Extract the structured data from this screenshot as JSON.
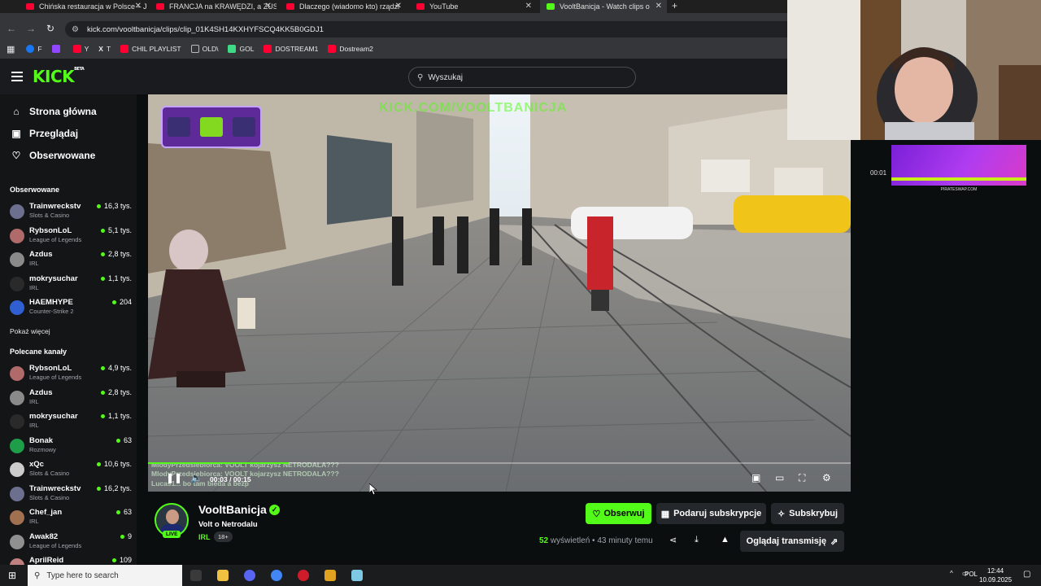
{
  "browser": {
    "tabs": [
      {
        "title": "Chińska restauracja w Polsce – J",
        "icon": "youtube-icon"
      },
      {
        "title": "FRANCJA na KRAWĘDZI, a ZUS",
        "icon": "youtube-icon"
      },
      {
        "title": "Dlaczego (wiadomo kto) rządzi",
        "icon": "youtube-icon"
      },
      {
        "title": "YouTube",
        "icon": "youtube-icon"
      },
      {
        "title": "VooltBanicja - Watch clips o",
        "icon": "kick-icon",
        "active": true
      }
    ],
    "url": "kick.com/vooltbanicja/clips/clip_01K4SH14KXHYFSCQ4KK5B0GDJ1",
    "bookmarks": [
      {
        "label": "F",
        "color": "#1877f2"
      },
      {
        "label": "",
        "color": "#9146ff"
      },
      {
        "label": "Y",
        "color": "#ff0033"
      },
      {
        "label": "T",
        "color": "#ffffff"
      },
      {
        "label": "CHIL PLAYLIST",
        "color": "#ff0033"
      },
      {
        "label": "OLD\\",
        "color": "#bbbbbb"
      },
      {
        "label": "GOL",
        "color": "#3ddc84"
      },
      {
        "label": "DOSTREAM1",
        "color": "#ff0033"
      },
      {
        "label": "Dostream2",
        "color": "#ff0033"
      }
    ]
  },
  "header": {
    "logo": "KICK",
    "logo_tag": "BETA",
    "search_placeholder": "Wyszukaj"
  },
  "sidebar": {
    "nav": [
      {
        "label": "Strona główna",
        "icon": "home-icon"
      },
      {
        "label": "Przeglądaj",
        "icon": "browse-icon"
      },
      {
        "label": "Obserwowane",
        "icon": "heart-icon"
      }
    ],
    "followed_heading": "Obserwowane",
    "followed": [
      {
        "name": "Trainwreckstv",
        "category": "Slots & Casino",
        "viewers": "16,3 tys.",
        "color": "#6d6f8f"
      },
      {
        "name": "RybsonLoL",
        "category": "League of Legends",
        "viewers": "5,1 tys.",
        "color": "#b06a6a"
      },
      {
        "name": "Azdus",
        "category": "IRL",
        "viewers": "2,8 tys.",
        "color": "#8a8a8a"
      },
      {
        "name": "mokrysuchar",
        "category": "IRL",
        "viewers": "1,1 tys.",
        "color": "#2a2a2a"
      },
      {
        "name": "HAEMHYPE",
        "category": "Counter-Strike 2",
        "viewers": "204",
        "color": "#2f5fd0"
      }
    ],
    "show_more": "Pokaż więcej",
    "recommended_heading": "Polecane kanały",
    "recommended": [
      {
        "name": "RybsonLoL",
        "category": "League of Legends",
        "viewers": "4,9 tys.",
        "color": "#b06a6a"
      },
      {
        "name": "Azdus",
        "category": "IRL",
        "viewers": "2,8 tys.",
        "color": "#8a8a8a"
      },
      {
        "name": "mokrysuchar",
        "category": "IRL",
        "viewers": "1,1 tys.",
        "color": "#2a2a2a"
      },
      {
        "name": "Bonak",
        "category": "Rozmowy",
        "viewers": "63",
        "color": "#1f9e4a"
      },
      {
        "name": "xQc",
        "category": "Slots & Casino",
        "viewers": "10,6 tys.",
        "color": "#cccccc"
      },
      {
        "name": "Trainwreckstv",
        "category": "Slots & Casino",
        "viewers": "16,2 tys.",
        "color": "#6d6f8f"
      },
      {
        "name": "Chef_jan",
        "category": "IRL",
        "viewers": "63",
        "color": "#a07050"
      },
      {
        "name": "Awak82",
        "category": "League of Legends",
        "viewers": "9",
        "color": "#909090"
      },
      {
        "name": "AprilReid",
        "category": "",
        "viewers": "109",
        "color": "#c08080"
      }
    ]
  },
  "player": {
    "watermark": "KICK.COM/VOOLTBANICJA",
    "chat_lines": [
      "MlodyPrzedsiebiorca: VOOLT kojarzysz NETRODALA???",
      "MlodyPrzedsiebiorca: VOOLT kojarzysz NETRODALA???",
      "Lucas1... bo tam bieda a bezp"
    ],
    "current_time": "00:03",
    "total_time": "00:15",
    "progress": 0.2
  },
  "right_panel": {
    "time": "00:01",
    "ad_footer": "PIRATESWAP.COM"
  },
  "channel": {
    "name": "VooltBanicja",
    "live_label": "LIVE",
    "title": "Volt o Netrodalu",
    "category": "IRL",
    "age": "18+",
    "follow_label": "Obserwuj",
    "gift_label": "Podaruj subskrypcje",
    "subscribe_label": "Subskrybuj",
    "views_count": "52",
    "views_word": "wyświetleń",
    "time_ago": "43 minuty temu",
    "watch_stream_label": "Oglądaj transmisję"
  },
  "taskbar": {
    "search_placeholder": "Type here to search",
    "language": "POL",
    "time": "12:44",
    "date": "10.09.2025"
  },
  "colors": {
    "accent": "#53fc18",
    "bg": "#0b0e0f",
    "sidebar": "#141517"
  }
}
